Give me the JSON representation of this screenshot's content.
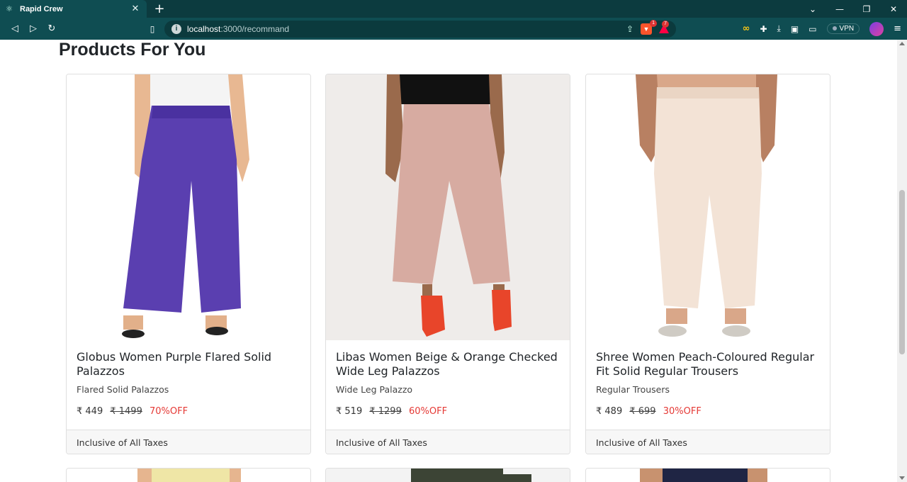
{
  "browser": {
    "tab_title": "Rapid Crew",
    "url_host": "localhost",
    "url_path": ":3000/recommand",
    "brave_badge": "1",
    "alert_badge": "7",
    "vpn_label": "VPN"
  },
  "page": {
    "heading": "Products For You"
  },
  "products": [
    {
      "name": "Globus Women Purple Flared Solid Palazzos",
      "subtitle": "Flared Solid Palazzos",
      "price": "₹ 449",
      "mrp": "₹ 1499",
      "discount": "70%OFF",
      "footer": "Inclusive of All Taxes",
      "color": "#5a3fb0"
    },
    {
      "name": "Libas Women Beige & Orange Checked Wide Leg Palazzos",
      "subtitle": "Wide Leg Palazzo",
      "price": "₹ 519",
      "mrp": "₹ 1299",
      "discount": "60%OFF",
      "footer": "Inclusive of All Taxes",
      "color": "#d6a9a0"
    },
    {
      "name": "Shree Women Peach-Coloured Regular Fit Solid Regular Trousers",
      "subtitle": "Regular Trousers",
      "price": "₹ 489",
      "mrp": "₹ 699",
      "discount": "30%OFF",
      "footer": "Inclusive of All Taxes",
      "color": "#f2e2d6"
    }
  ],
  "colors": {
    "discount": "#e53935",
    "chrome": "#0f4d52"
  }
}
